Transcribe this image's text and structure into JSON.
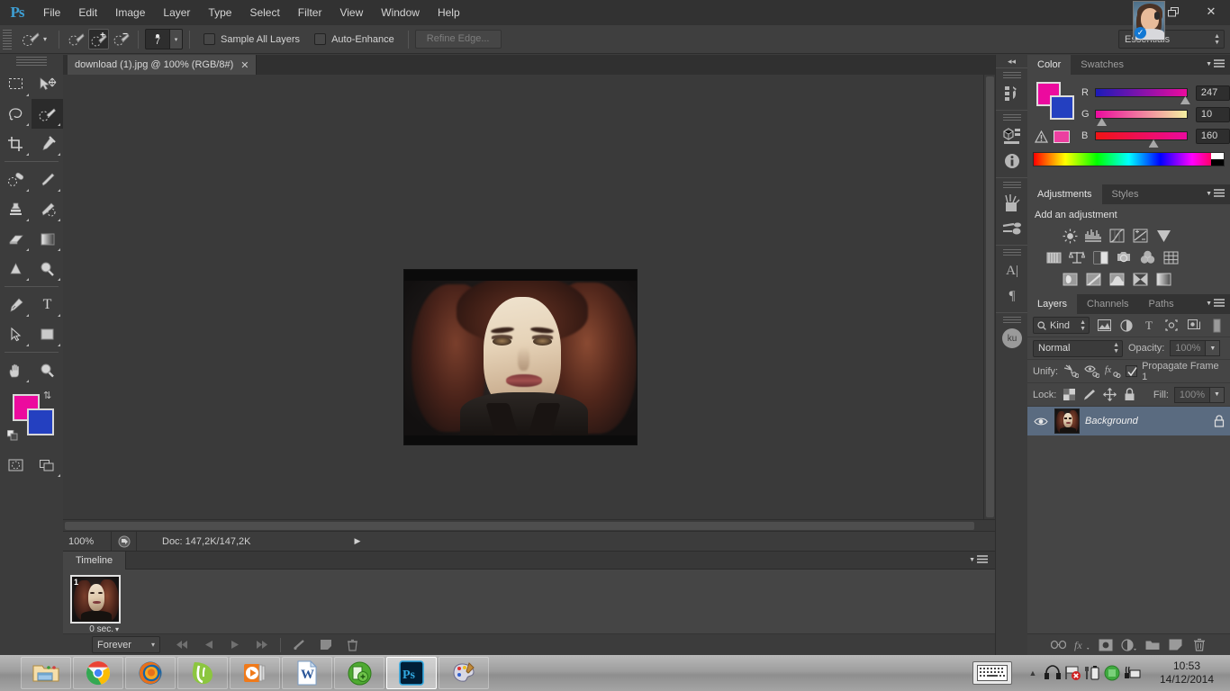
{
  "app": {
    "logo": "Ps",
    "menus": [
      "File",
      "Edit",
      "Image",
      "Layer",
      "Type",
      "Select",
      "Filter",
      "View",
      "Window",
      "Help"
    ],
    "window_controls": {
      "restore": "restore-icon",
      "close": "✕"
    },
    "avatar_badge": "✓"
  },
  "options_bar": {
    "tool_preset_icon": "quick-selection-tool-icon",
    "preset_dropdown": "▾",
    "modes": [
      "new-selection-icon",
      "add-to-selection-icon",
      "subtract-from-selection-icon"
    ],
    "active_mode_index": 1,
    "brush_size": "7",
    "size_dropdown": "▾",
    "sample_all_layers": {
      "label": "Sample All Layers",
      "checked": false
    },
    "auto_enhance": {
      "label": "Auto-Enhance",
      "checked": false
    },
    "refine_edge": {
      "label": "Refine Edge...",
      "enabled": false
    },
    "workspace": "Essentials"
  },
  "toolbar": {
    "tools": [
      {
        "name": "rectangular-marquee-tool",
        "glyph": "marquee"
      },
      {
        "name": "move-tool",
        "glyph": "move"
      },
      {
        "name": "lasso-tool",
        "glyph": "lasso"
      },
      {
        "name": "quick-selection-tool",
        "glyph": "quickselect"
      },
      {
        "name": "crop-tool",
        "glyph": "crop"
      },
      {
        "name": "eyedropper-tool",
        "glyph": "eyedropper"
      },
      {
        "name": "spot-healing-brush-tool",
        "glyph": "healing"
      },
      {
        "name": "brush-tool",
        "glyph": "brush"
      },
      {
        "name": "clone-stamp-tool",
        "glyph": "stamp"
      },
      {
        "name": "history-brush-tool",
        "glyph": "historybrush"
      },
      {
        "name": "eraser-tool",
        "glyph": "eraser"
      },
      {
        "name": "gradient-tool",
        "glyph": "gradient"
      },
      {
        "name": "blur-tool",
        "glyph": "blur"
      },
      {
        "name": "dodge-tool",
        "glyph": "dodge"
      },
      {
        "name": "pen-tool",
        "glyph": "pen"
      },
      {
        "name": "horizontal-type-tool",
        "glyph": "type"
      },
      {
        "name": "path-selection-tool",
        "glyph": "pathselect"
      },
      {
        "name": "rectangle-tool",
        "glyph": "rectangle"
      },
      {
        "name": "hand-tool",
        "glyph": "hand"
      },
      {
        "name": "zoom-tool",
        "glyph": "zoom"
      }
    ],
    "active_tool_index": 3,
    "foreground_color": "#ec0a9e",
    "background_color": "#2440c0",
    "swap_icon": "swap-colors-icon",
    "default_colors_icon": "default-colors-icon",
    "quick_mask_icon": "quick-mask-icon",
    "screen_mode_icon": "screen-mode-icon"
  },
  "document": {
    "tab_title": "download (1).jpg @ 100% (RGB/8#)",
    "close_glyph": "✕",
    "zoom_level": "100%",
    "doc_info": "Doc: 147,2K/147,2K",
    "status_arrow": "▶"
  },
  "timeline": {
    "tab_label": "Timeline",
    "frames": [
      {
        "number": "1",
        "delay": "0 sec."
      }
    ],
    "delay_arrow": "▾",
    "loop_option": "Forever",
    "loop_arrow": "▾",
    "controls": [
      "select-first-frame-icon",
      "select-previous-frame-icon",
      "play-animation-icon",
      "select-next-frame-icon"
    ],
    "tween_icon": "tween-frames-icon",
    "duplicate_icon": "duplicate-frame-icon",
    "delete_icon": "delete-frame-icon",
    "panel_menu_icon": "panel-menu-icon"
  },
  "rail": {
    "collapse_icon": "◂◂",
    "groups": [
      [
        "history-panel-icon"
      ],
      [
        "3d-panel-icon",
        "info-panel-icon"
      ],
      [
        "brush-panel-icon",
        "brush-presets-panel-icon"
      ],
      [
        "character-panel-icon",
        "paragraph-panel-icon"
      ],
      [
        "ku-panel-icon"
      ]
    ],
    "ku_label": "ku"
  },
  "color_panel": {
    "tabs": [
      "Color",
      "Swatches"
    ],
    "active_tab": "Color",
    "foreground_color": "#ec0a9e",
    "background_color": "#2440c0",
    "warning_icon": "out-of-gamut-warning-icon",
    "warning_swatch": "#ec3fa0",
    "channels": [
      {
        "label": "R",
        "value": "247",
        "pos_pct": 96.8
      },
      {
        "label": "G",
        "value": "10",
        "pos_pct": 4.0
      },
      {
        "label": "B",
        "value": "160",
        "pos_pct": 62.7
      }
    ],
    "menu_icon": "panel-menu-icon"
  },
  "adjustments_panel": {
    "tabs": [
      "Adjustments",
      "Styles"
    ],
    "active_tab": "Adjustments",
    "title": "Add an adjustment",
    "rows": [
      [
        "brightness-contrast-icon",
        "levels-icon",
        "curves-icon",
        "exposure-icon",
        "vibrance-icon"
      ],
      [
        "hue-saturation-icon",
        "color-balance-icon",
        "black-white-icon",
        "photo-filter-icon",
        "channel-mixer-icon",
        "color-lookup-icon"
      ],
      [
        "invert-icon",
        "posterize-icon",
        "threshold-icon",
        "selective-color-icon",
        "gradient-map-icon"
      ]
    ],
    "menu_icon": "panel-menu-icon"
  },
  "layers_panel": {
    "tabs": [
      "Layers",
      "Channels",
      "Paths"
    ],
    "active_tab": "Layers",
    "filter_kind": "Kind",
    "filter_icons": [
      "filter-pixel-icon",
      "filter-adjustment-icon",
      "filter-type-icon",
      "filter-shape-icon",
      "filter-smart-object-icon"
    ],
    "filter_toggle_icon": "filter-toggle-icon",
    "blend_mode": "Normal",
    "opacity_label": "Opacity:",
    "opacity_value": "100%",
    "unify_label": "Unify:",
    "unify_icons": [
      "unify-position-icon",
      "unify-visibility-icon",
      "unify-style-icon"
    ],
    "propagate_label": "Propagate Frame 1",
    "propagate_checked": true,
    "lock_label": "Lock:",
    "lock_icons": [
      "lock-transparent-pixels-icon",
      "lock-image-pixels-icon",
      "lock-position-icon",
      "lock-all-icon"
    ],
    "fill_label": "Fill:",
    "fill_value": "100%",
    "layers": [
      {
        "name": "Background",
        "visible": true,
        "locked": true,
        "eye_icon": "eye-icon",
        "lock_icon": "lock-icon"
      }
    ],
    "footer_icons": [
      "link-layers-icon",
      "layer-style-icon",
      "layer-mask-icon",
      "new-adjustment-layer-icon",
      "new-group-icon",
      "new-layer-icon",
      "delete-layer-icon"
    ],
    "menu_icon": "panel-menu-icon"
  },
  "taskbar": {
    "items": [
      {
        "name": "file-explorer",
        "glyph": "explorer"
      },
      {
        "name": "google-chrome",
        "glyph": "chrome"
      },
      {
        "name": "mozilla-firefox",
        "glyph": "firefox"
      },
      {
        "name": "green-app",
        "glyph": "greenapp"
      },
      {
        "name": "media-player",
        "glyph": "mediaplayer"
      },
      {
        "name": "microsoft-word",
        "glyph": "word"
      },
      {
        "name": "green-round-app",
        "glyph": "greenround"
      },
      {
        "name": "adobe-photoshop",
        "glyph": "photoshop",
        "active": true
      },
      {
        "name": "paint",
        "glyph": "paint"
      }
    ],
    "tray": {
      "keyboard_icon": "on-screen-keyboard-icon",
      "show_hidden_icon": "▲",
      "icons": [
        "network-printer-icon",
        "flag-error-icon",
        "battery-icon",
        "green-status-icon",
        "network-icon"
      ],
      "time": "10:53",
      "date": "14/12/2014"
    }
  }
}
